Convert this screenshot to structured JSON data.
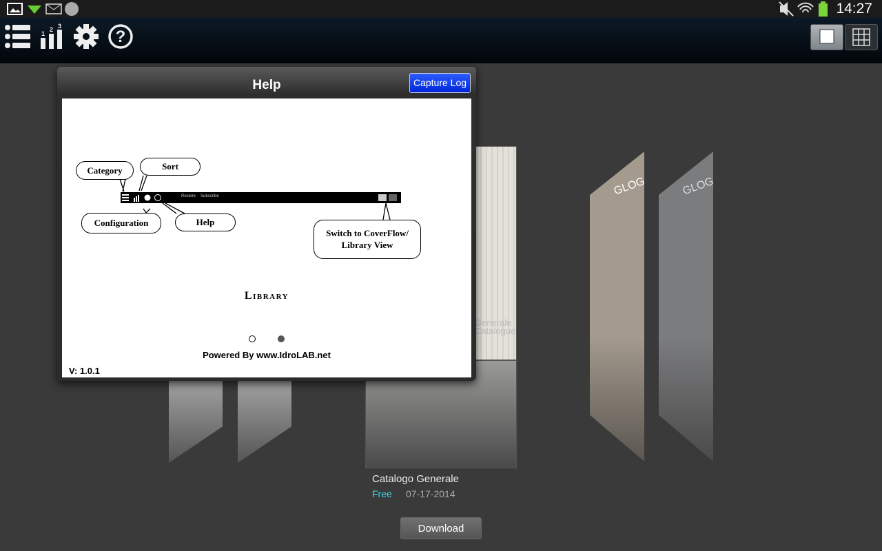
{
  "status_bar": {
    "time": "14:27",
    "icons": [
      "image-icon",
      "download-icon",
      "email-icon",
      "app-icon",
      "mute-icon",
      "wifi-icon",
      "battery-icon"
    ],
    "battery_color": "#7bd43a"
  },
  "toolbar": {
    "icons": [
      "category-list-icon",
      "sort-icon",
      "gear-icon",
      "help-icon"
    ],
    "view_modes": [
      "coverflow-view-icon",
      "library-grid-icon"
    ],
    "selected_view": "coverflow"
  },
  "dialog": {
    "title": "Help",
    "capture_button": "Capture Log",
    "illustration": {
      "bubbles": {
        "category": "Category",
        "sort": "Sort",
        "configuration": "Configuration",
        "help": "Help",
        "switch_view": "Switch to CoverFlow/ Library View"
      },
      "bar_links": [
        "Restore",
        "Subscribe"
      ]
    },
    "page_title": "Library",
    "pages": 2,
    "current_page": 2,
    "powered_by": "Powered By www.IdroLAB.net",
    "version": "V: 1.0.1"
  },
  "catalog": {
    "title": "Catalogo Generale",
    "price": "Free",
    "date": "07-17-2014",
    "download_label": "Download",
    "cover_text": "Generale Catalogue",
    "side_cover_logo": "GLOGO",
    "accent": "#33ddee"
  }
}
